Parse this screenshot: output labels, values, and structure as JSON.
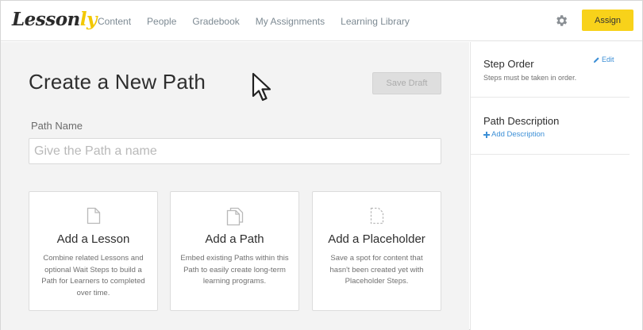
{
  "brand": {
    "logo_main": "Lesson",
    "logo_accent": "ly",
    "accent_color": "#f8d21a"
  },
  "nav": {
    "items": [
      "Content",
      "People",
      "Gradebook",
      "My Assignments",
      "Learning Library"
    ]
  },
  "header": {
    "settings_icon": "gear-icon",
    "assign_label": "Assign"
  },
  "main": {
    "title": "Create a New Path",
    "save_draft_label": "Save Draft",
    "path_name_label": "Path Name",
    "path_name_placeholder": "Give the Path a name",
    "path_name_value": "",
    "cards": [
      {
        "icon": "document-icon",
        "title": "Add a Lesson",
        "description": "Combine related Lessons and optional Wait Steps to build a Path for Learners to completed over time."
      },
      {
        "icon": "copy-icon",
        "title": "Add a Path",
        "description": "Embed existing Paths within this Path to easily create long-term learning programs."
      },
      {
        "icon": "dashed-document-icon",
        "title": "Add a Placeholder",
        "description": "Save a spot for content that hasn't been created yet with Placeholder Steps."
      }
    ]
  },
  "sidebar": {
    "step_order": {
      "title": "Step Order",
      "edit_label": "Edit",
      "subtitle": "Steps must be taken in order."
    },
    "path_description": {
      "title": "Path Description",
      "add_label": "Add Description"
    },
    "link_color": "#3c8fd6"
  }
}
